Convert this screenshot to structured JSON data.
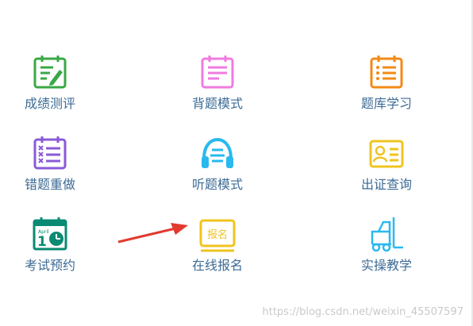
{
  "colors": {
    "label": "#3c6b95",
    "green": "#3aa845",
    "pink": "#f07be0",
    "orange": "#f38a17",
    "purple": "#8a5ad7",
    "cyan": "#29b9ef",
    "yellow": "#efc41f",
    "teal": "#0a8a73",
    "red": "#e23a2e"
  },
  "menu": {
    "items": [
      {
        "label": "成绩测评",
        "icon": "notepad-pencil-icon"
      },
      {
        "label": "背题模式",
        "icon": "notebook-lines-icon"
      },
      {
        "label": "题库学习",
        "icon": "list-notebook-icon"
      },
      {
        "label": "错题重做",
        "icon": "wrong-list-icon"
      },
      {
        "label": "听题模式",
        "icon": "headphones-icon"
      },
      {
        "label": "出证查询",
        "icon": "id-card-icon"
      },
      {
        "label": "考试预约",
        "icon": "calendar-clock-icon"
      },
      {
        "label": "在线报名",
        "icon": "signup-badge-icon",
        "badge_text": "报名"
      },
      {
        "label": "实操教学",
        "icon": "forklift-icon"
      }
    ]
  },
  "calendar_icon": {
    "month": "April",
    "day": "1"
  },
  "watermark": "https://blog.csdn.net/weixin_45507597"
}
